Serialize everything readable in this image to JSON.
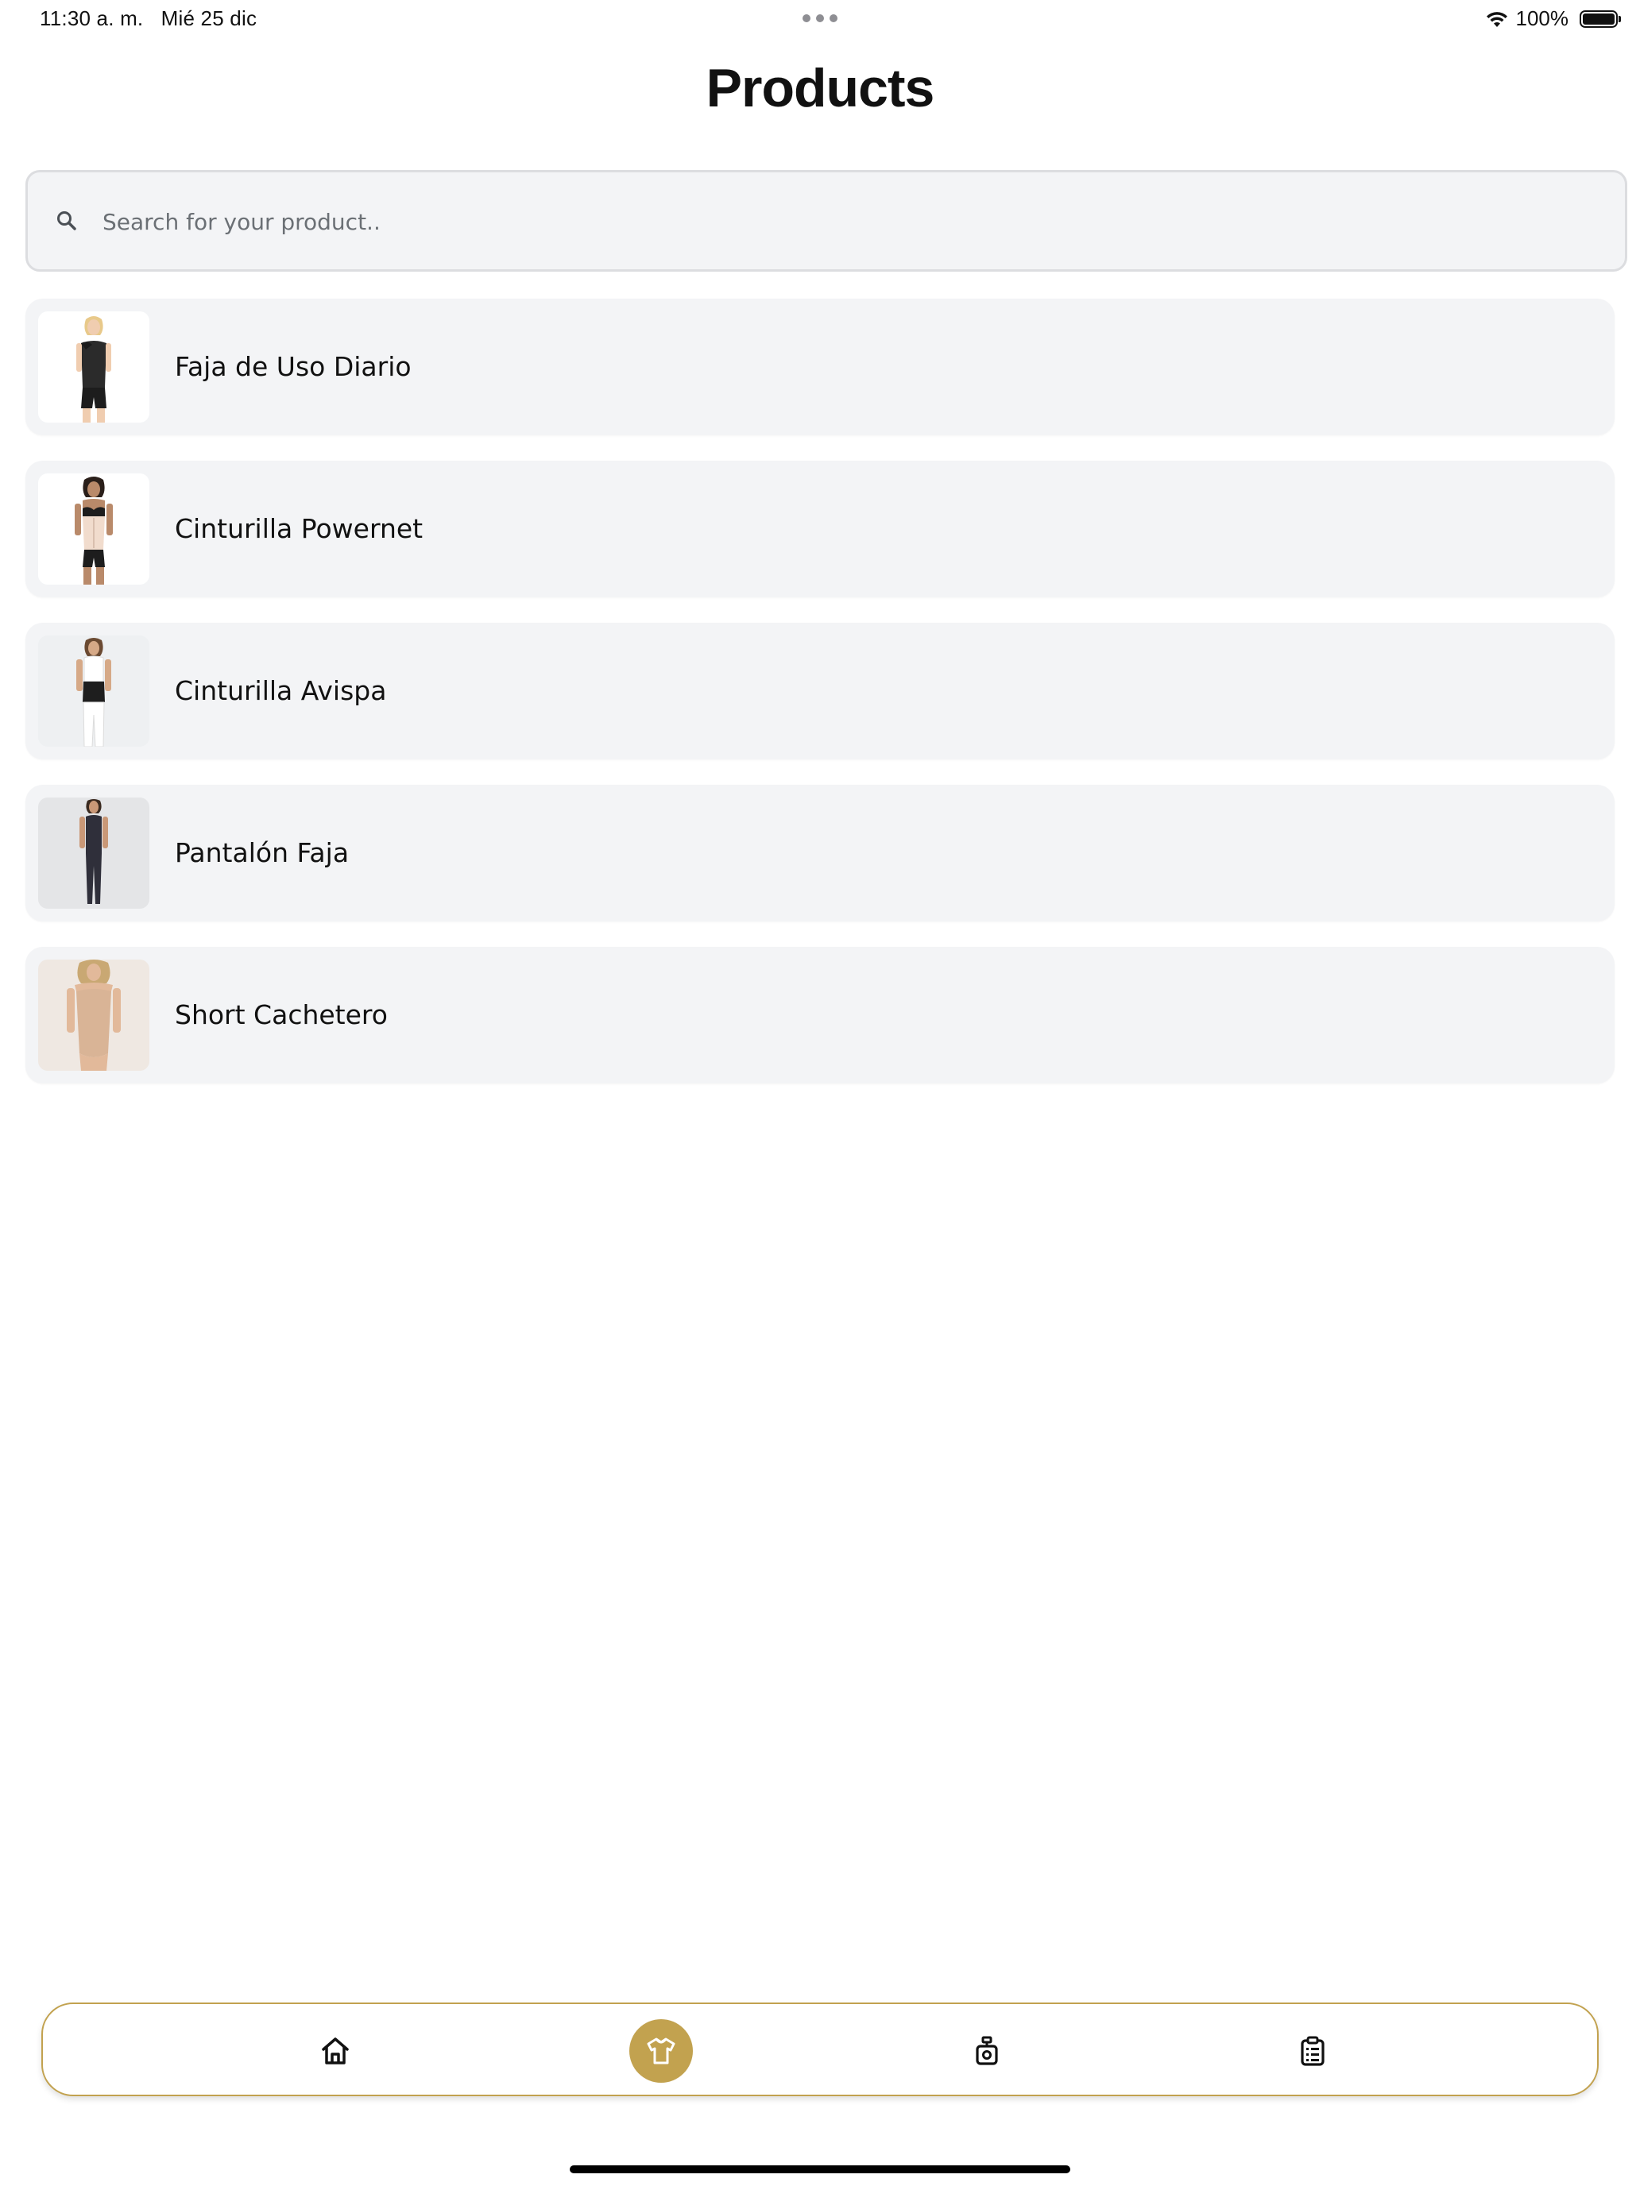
{
  "status_bar": {
    "time": "11:30 a. m.",
    "date": "Mié 25 dic",
    "battery": "100%",
    "wifi_icon": "wifi-icon",
    "battery_icon": "battery-icon"
  },
  "header": {
    "title": "Products"
  },
  "search": {
    "placeholder": "Search for your product..",
    "value": "",
    "icon": "search-icon"
  },
  "products": [
    {
      "name": "Faja de Uso Diario",
      "image": "black-bodysuit-shaper"
    },
    {
      "name": "Cinturilla Powernet",
      "image": "beige-waist-cincher"
    },
    {
      "name": "Cinturilla Avispa",
      "image": "black-waist-belt"
    },
    {
      "name": "Pantalón Faja",
      "image": "full-body-legging-shaper"
    },
    {
      "name": "Short Cachetero",
      "image": "nude-strapless-bodysuit"
    }
  ],
  "bottom_nav": {
    "items": [
      {
        "icon": "home-icon",
        "active": false
      },
      {
        "icon": "shirt-icon",
        "active": true
      },
      {
        "icon": "perfume-bottle-icon",
        "active": false
      },
      {
        "icon": "clipboard-list-icon",
        "active": false
      }
    ]
  },
  "colors": {
    "accent": "#c2a24f",
    "card_background": "#f3f4f6",
    "search_border": "#dcdde0",
    "text": "#111111",
    "placeholder": "#6b7075"
  }
}
